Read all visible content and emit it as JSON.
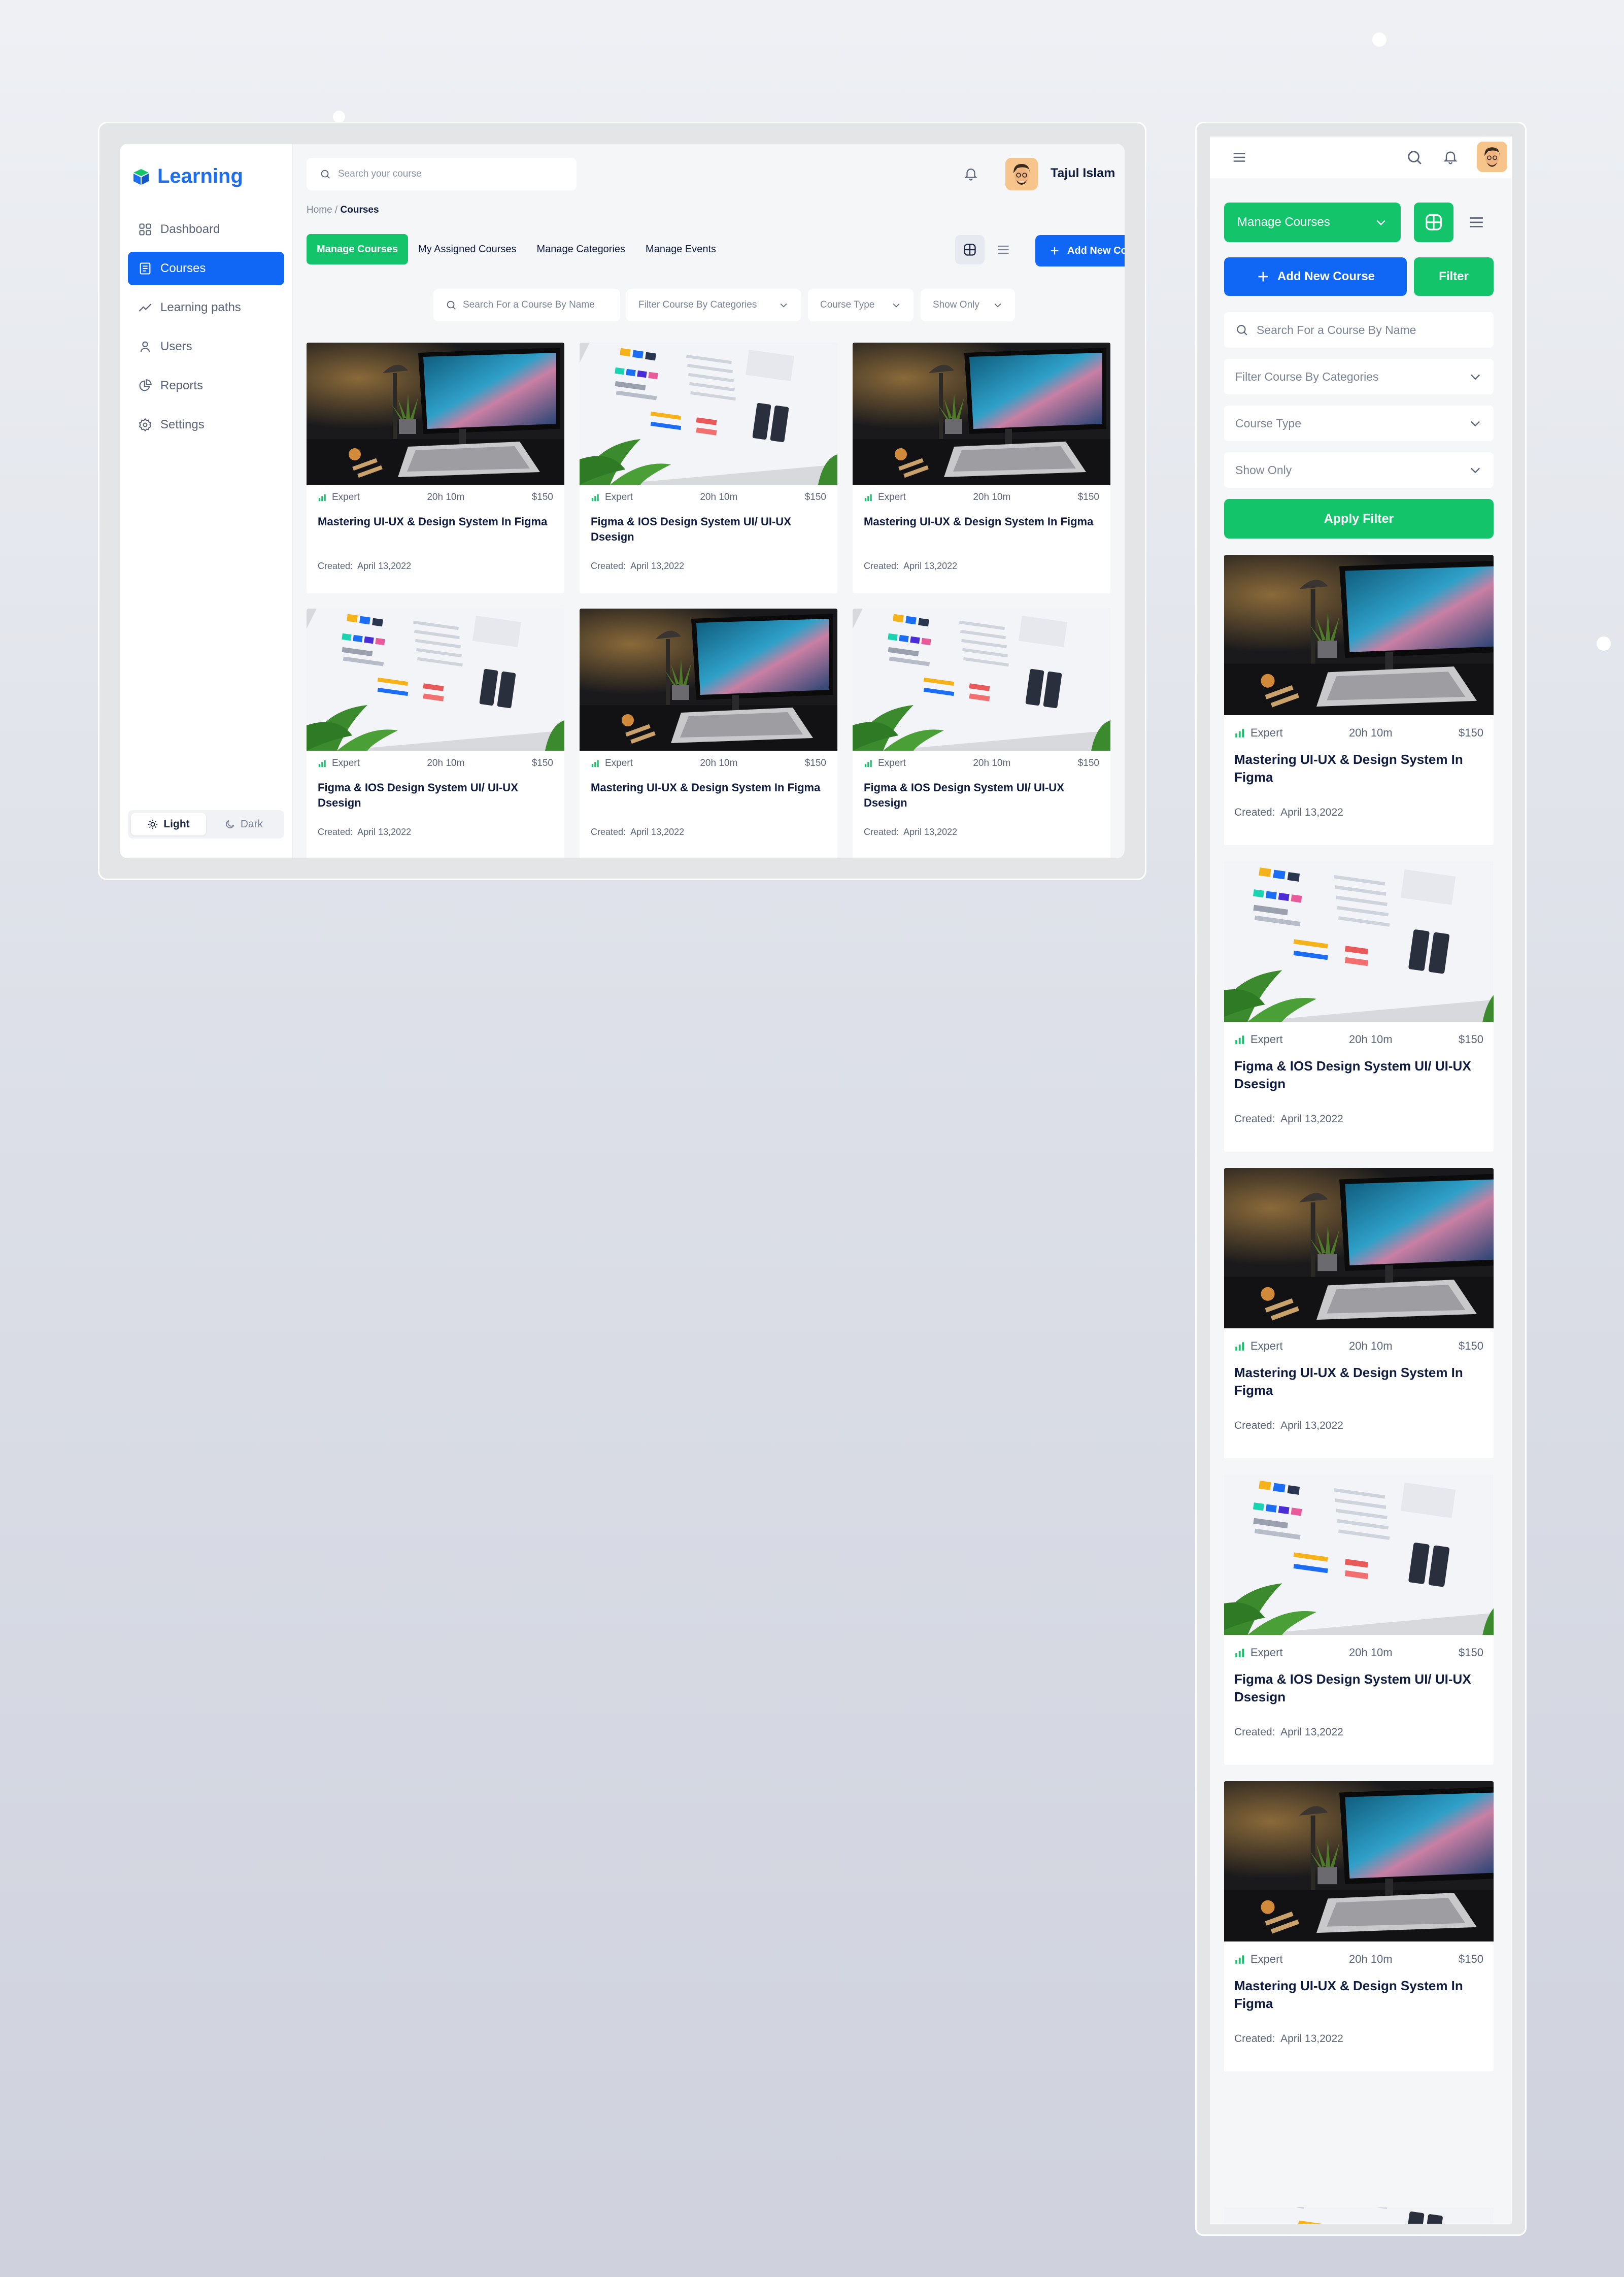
{
  "app": {
    "name": "Learning",
    "brand_color": "#1167f5",
    "accent_green": "#14c46b"
  },
  "sidebar": {
    "items": [
      {
        "label": "Dashboard",
        "icon": "grid-icon",
        "active": false
      },
      {
        "label": "Courses",
        "icon": "book-icon",
        "active": true
      },
      {
        "label": "Learning paths",
        "icon": "trend-icon",
        "active": false
      },
      {
        "label": "Users",
        "icon": "user-icon",
        "active": false
      },
      {
        "label": "Reports",
        "icon": "pie-chart-icon",
        "active": false
      },
      {
        "label": "Settings",
        "icon": "gear-icon",
        "active": false
      }
    ],
    "theme": {
      "light": "Light",
      "dark": "Dark",
      "selected": "Light"
    }
  },
  "header": {
    "search_placeholder": "Search your course",
    "user_name": "Tajul Islam"
  },
  "breadcrumb": {
    "home": "Home",
    "separator": "/",
    "current": "Courses"
  },
  "tabs": [
    {
      "label": "Manage Courses",
      "active": true
    },
    {
      "label": "My Assigned Courses",
      "active": false
    },
    {
      "label": "Manage Categories",
      "active": false
    },
    {
      "label": "Manage Events",
      "active": false
    }
  ],
  "actions": {
    "add_course": "Add New Course",
    "filter": "Filter",
    "apply_filter": "Apply Filter"
  },
  "filters": {
    "search_placeholder": "Search For a Course By Name",
    "category": "Filter Course By Categories",
    "course_type": "Course Type",
    "show_only": "Show Only"
  },
  "courses": [
    {
      "level": "Expert",
      "duration": "20h 10m",
      "price": "$150",
      "title": "Mastering UI-UX & Design System In Figma",
      "created_label": "Created:",
      "created_date": "April 13,2022",
      "image": "desk-monitor"
    },
    {
      "level": "Expert",
      "duration": "20h 10m",
      "price": "$150",
      "title": "Figma & IOS Design System UI/ UI-UX Dsesign",
      "created_label": "Created:",
      "created_date": "April 13,2022",
      "image": "design-screen"
    },
    {
      "level": "Expert",
      "duration": "20h 10m",
      "price": "$150",
      "title": "Mastering UI-UX & Design System In Figma",
      "created_label": "Created:",
      "created_date": "April 13,2022",
      "image": "desk-monitor"
    },
    {
      "level": "Expert",
      "duration": "20h 10m",
      "price": "$150",
      "title": "Figma & IOS Design System UI/ UI-UX Dsesign",
      "created_label": "Created:",
      "created_date": "April 13,2022",
      "image": "design-screen"
    },
    {
      "level": "Expert",
      "duration": "20h 10m",
      "price": "$150",
      "title": "Mastering UI-UX & Design System In Figma",
      "created_label": "Created:",
      "created_date": "April 13,2022",
      "image": "desk-monitor"
    },
    {
      "level": "Expert",
      "duration": "20h 10m",
      "price": "$150",
      "title": "Figma & IOS Design System UI/ UI-UX Dsesign",
      "created_label": "Created:",
      "created_date": "April 13,2022",
      "image": "design-screen"
    }
  ],
  "mobile": {
    "dropdown_label": "Manage Courses",
    "courses": [
      {
        "level": "Expert",
        "duration": "20h 10m",
        "price": "$150",
        "title": "Mastering UI-UX & Design System In Figma",
        "created_label": "Created:",
        "created_date": "April 13,2022",
        "image": "desk-monitor"
      },
      {
        "level": "Expert",
        "duration": "20h 10m",
        "price": "$150",
        "title": "Figma & IOS Design System UI/ UI-UX Dsesign",
        "created_label": "Created:",
        "created_date": "April 13,2022",
        "image": "design-screen"
      },
      {
        "level": "Expert",
        "duration": "20h 10m",
        "price": "$150",
        "title": "Mastering UI-UX & Design System In Figma",
        "created_label": "Created:",
        "created_date": "April 13,2022",
        "image": "desk-monitor"
      },
      {
        "level": "Expert",
        "duration": "20h 10m",
        "price": "$150",
        "title": "Figma & IOS Design System UI/ UI-UX Dsesign",
        "created_label": "Created:",
        "created_date": "April 13,2022",
        "image": "design-screen"
      },
      {
        "level": "Expert",
        "duration": "20h 10m",
        "price": "$150",
        "title": "Mastering UI-UX & Design System In Figma",
        "created_label": "Created:",
        "created_date": "April 13,2022",
        "image": "desk-monitor"
      }
    ]
  }
}
